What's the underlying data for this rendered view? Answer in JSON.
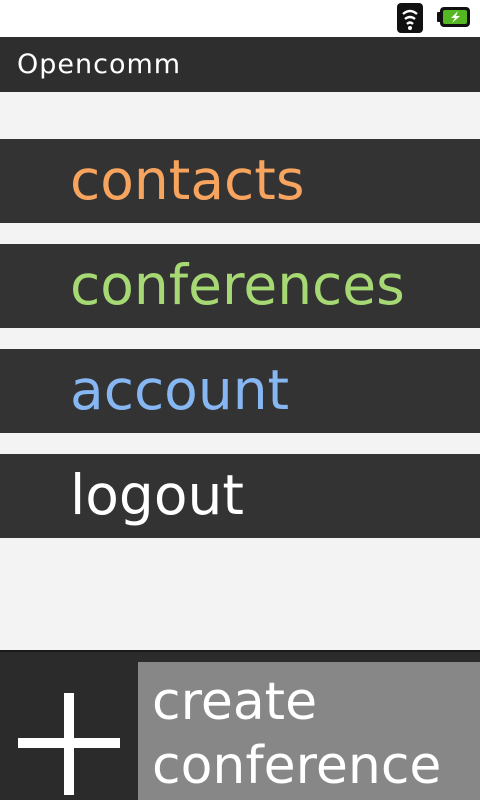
{
  "status_bar": {
    "icons": [
      "wifi-icon",
      "battery-charging-icon"
    ],
    "battery_color": "#55b822"
  },
  "app": {
    "title": "Opencomm"
  },
  "menu": [
    {
      "label": "contacts",
      "color": "#f7a45e"
    },
    {
      "label": "conferences",
      "color": "#a6d873"
    },
    {
      "label": "account",
      "color": "#86b7f2"
    },
    {
      "label": "logout",
      "color": "#ffffff"
    }
  ],
  "bottom_bar": {
    "plus_icon": "plus-icon",
    "create_label_line1": "create",
    "create_label_line2": "conference"
  }
}
